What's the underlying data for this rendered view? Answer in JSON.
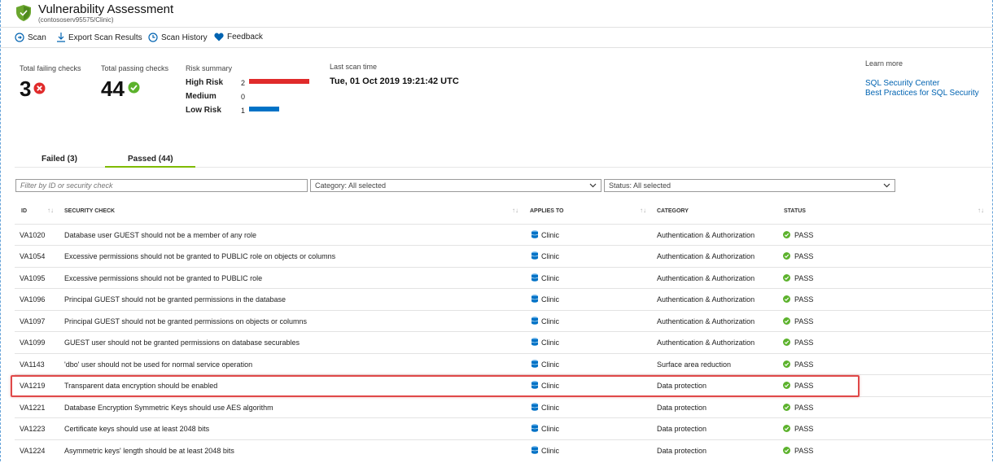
{
  "header": {
    "title": "Vulnerability Assessment",
    "subtitle": "(contososerv95575/Clinic)"
  },
  "toolbar": {
    "scan": "Scan",
    "export": "Export Scan Results",
    "history": "Scan History",
    "feedback": "Feedback"
  },
  "summary": {
    "failing_label": "Total failing checks",
    "failing_value": "3",
    "passing_label": "Total passing checks",
    "passing_value": "44",
    "risk_label": "Risk summary",
    "risk": [
      {
        "level": "High Risk",
        "count": "2",
        "color": "#e02b2b"
      },
      {
        "level": "Medium",
        "count": "0",
        "color": "#f0a30a"
      },
      {
        "level": "Low Risk",
        "count": "1",
        "color": "#0072c6"
      }
    ],
    "last_scan_label": "Last scan time",
    "last_scan_value": "Tue, 01 Oct 2019 19:21:42 UTC"
  },
  "learn_more": {
    "label": "Learn more",
    "links": [
      "SQL Security Center",
      "Best Practices for SQL Security"
    ]
  },
  "tabs": [
    {
      "label": "Failed (3)",
      "active": false
    },
    {
      "label": "Passed (44)",
      "active": true
    }
  ],
  "filters": {
    "search_placeholder": "Filter by ID or security check",
    "category": "Category: All selected",
    "status": "Status: All selected"
  },
  "table": {
    "headers": [
      "ID",
      "SECURITY CHECK",
      "APPLIES TO",
      "CATEGORY",
      "STATUS"
    ],
    "rows": [
      {
        "id": "VA1020",
        "check": "Database user GUEST should not be a member of any role",
        "applies": "Clinic",
        "category": "Authentication & Authorization",
        "status": "PASS"
      },
      {
        "id": "VA1054",
        "check": "Excessive permissions should not be granted to PUBLIC role on objects or columns",
        "applies": "Clinic",
        "category": "Authentication & Authorization",
        "status": "PASS"
      },
      {
        "id": "VA1095",
        "check": "Excessive permissions should not be granted to PUBLIC role",
        "applies": "Clinic",
        "category": "Authentication & Authorization",
        "status": "PASS"
      },
      {
        "id": "VA1096",
        "check": "Principal GUEST should not be granted permissions in the database",
        "applies": "Clinic",
        "category": "Authentication & Authorization",
        "status": "PASS"
      },
      {
        "id": "VA1097",
        "check": "Principal GUEST should not be granted permissions on objects or columns",
        "applies": "Clinic",
        "category": "Authentication & Authorization",
        "status": "PASS"
      },
      {
        "id": "VA1099",
        "check": "GUEST user should not be granted permissions on database securables",
        "applies": "Clinic",
        "category": "Authentication & Authorization",
        "status": "PASS"
      },
      {
        "id": "VA1143",
        "check": "'dbo' user should not be used for normal service operation",
        "applies": "Clinic",
        "category": "Surface area reduction",
        "status": "PASS"
      },
      {
        "id": "VA1219",
        "check": "Transparent data encryption should be enabled",
        "applies": "Clinic",
        "category": "Data protection",
        "status": "PASS"
      },
      {
        "id": "VA1221",
        "check": "Database Encryption Symmetric Keys should use AES algorithm",
        "applies": "Clinic",
        "category": "Data protection",
        "status": "PASS"
      },
      {
        "id": "VA1223",
        "check": "Certificate keys should use at least 2048 bits",
        "applies": "Clinic",
        "category": "Data protection",
        "status": "PASS"
      },
      {
        "id": "VA1224",
        "check": "Asymmetric keys' length should be at least 2048 bits",
        "applies": "Clinic",
        "category": "Data protection",
        "status": "PASS"
      }
    ]
  },
  "colors": {
    "accent": "#0063b1",
    "pass": "#5cb22c",
    "fail": "#e02b2b",
    "tab_active": "#7fba00",
    "highlight": "#e04848"
  }
}
